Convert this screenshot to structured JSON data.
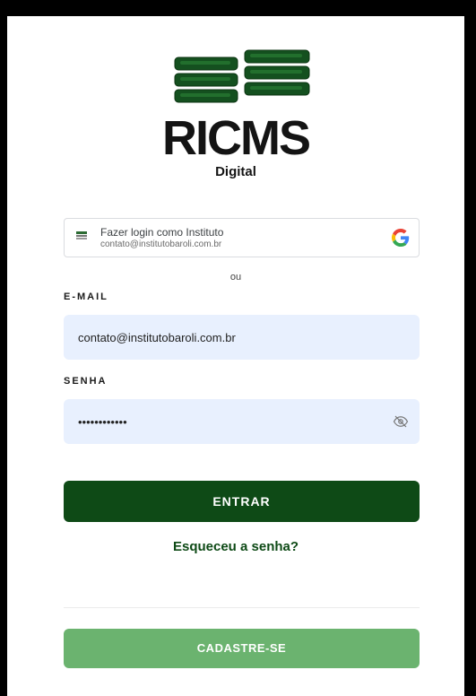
{
  "brand": {
    "name": "RICMS",
    "subtitle": "Digital"
  },
  "google_login": {
    "account_label": "Fazer login como Instituto",
    "email": "contato@institutobaroli.com.br"
  },
  "separator_text": "ou",
  "form": {
    "email_label": "E-MAIL",
    "email_value": "contato@institutobaroli.com.br",
    "password_label": "SENHA",
    "password_value": "••••••••••••"
  },
  "actions": {
    "login_label": "ENTRAR",
    "forgot_label": "Esqueceu a senha?",
    "signup_label": "CADASTRE-SE"
  },
  "colors": {
    "primary": "#0e4a16",
    "secondary": "#6bb36f",
    "input_bg": "#e8f0fe"
  }
}
